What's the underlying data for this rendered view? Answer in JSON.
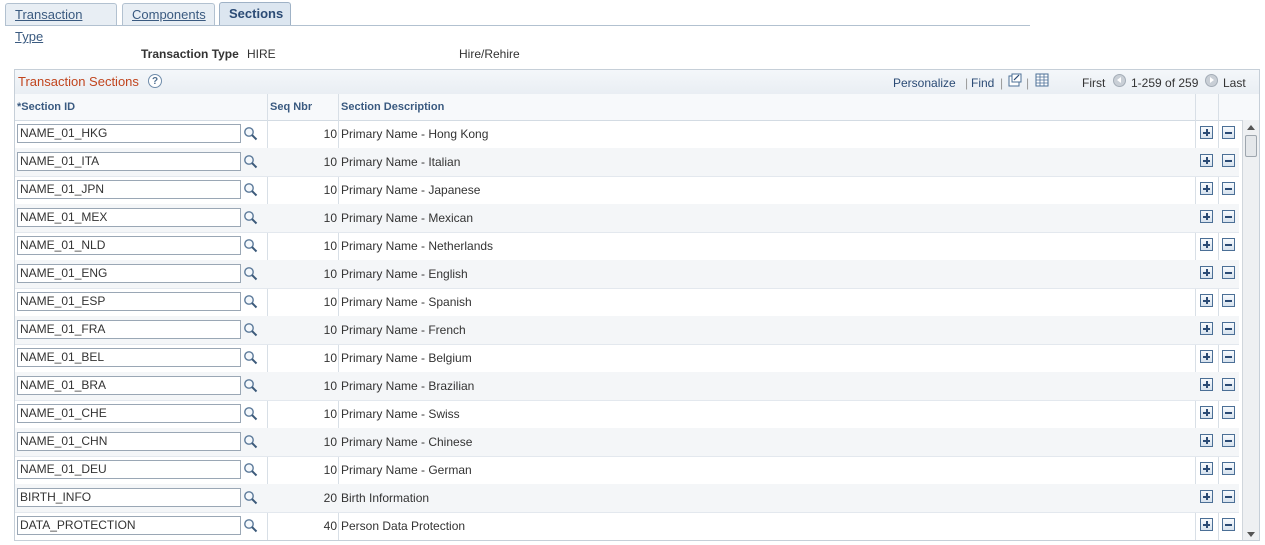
{
  "tabs": [
    {
      "label": "Transaction Type",
      "active": false
    },
    {
      "label": "Components",
      "active": false
    },
    {
      "label": "Sections",
      "active": true
    }
  ],
  "header": {
    "transaction_type_label": "Transaction Type",
    "transaction_type_value": "HIRE",
    "transaction_type_desc": "Hire/Rehire"
  },
  "grid": {
    "title": "Transaction Sections",
    "help": "?",
    "personalize": "Personalize",
    "find": "Find",
    "first": "First",
    "range": "1-259 of 259",
    "last": "Last",
    "columns": {
      "section_id": "*Section ID",
      "seq_nbr": "Seq Nbr",
      "section_description": "Section Description"
    },
    "rows": [
      {
        "section_id": "NAME_01_HKG",
        "seq": "10",
        "desc": "Primary Name - Hong Kong"
      },
      {
        "section_id": "NAME_01_ITA",
        "seq": "10",
        "desc": "Primary Name - Italian"
      },
      {
        "section_id": "NAME_01_JPN",
        "seq": "10",
        "desc": "Primary Name - Japanese"
      },
      {
        "section_id": "NAME_01_MEX",
        "seq": "10",
        "desc": "Primary Name - Mexican"
      },
      {
        "section_id": "NAME_01_NLD",
        "seq": "10",
        "desc": "Primary Name - Netherlands"
      },
      {
        "section_id": "NAME_01_ENG",
        "seq": "10",
        "desc": "Primary Name - English"
      },
      {
        "section_id": "NAME_01_ESP",
        "seq": "10",
        "desc": "Primary Name - Spanish"
      },
      {
        "section_id": "NAME_01_FRA",
        "seq": "10",
        "desc": "Primary Name - French"
      },
      {
        "section_id": "NAME_01_BEL",
        "seq": "10",
        "desc": "Primary Name - Belgium"
      },
      {
        "section_id": "NAME_01_BRA",
        "seq": "10",
        "desc": "Primary Name - Brazilian"
      },
      {
        "section_id": "NAME_01_CHE",
        "seq": "10",
        "desc": "Primary Name - Swiss"
      },
      {
        "section_id": "NAME_01_CHN",
        "seq": "10",
        "desc": "Primary Name - Chinese"
      },
      {
        "section_id": "NAME_01_DEU",
        "seq": "10",
        "desc": "Primary Name - German"
      },
      {
        "section_id": "BIRTH_INFO",
        "seq": "20",
        "desc": "Birth Information"
      },
      {
        "section_id": "DATA_PROTECTION",
        "seq": "40",
        "desc": "Person Data Protection"
      }
    ]
  },
  "icons": {
    "lookup": "magnifier-icon",
    "add": "plus-icon",
    "delete": "minus-icon",
    "view_all": "new-window-icon",
    "download": "spreadsheet-icon"
  },
  "colors": {
    "tab_border": "#b2c1d0",
    "grid_title": "#c1451e",
    "link": "#2b4b75"
  }
}
